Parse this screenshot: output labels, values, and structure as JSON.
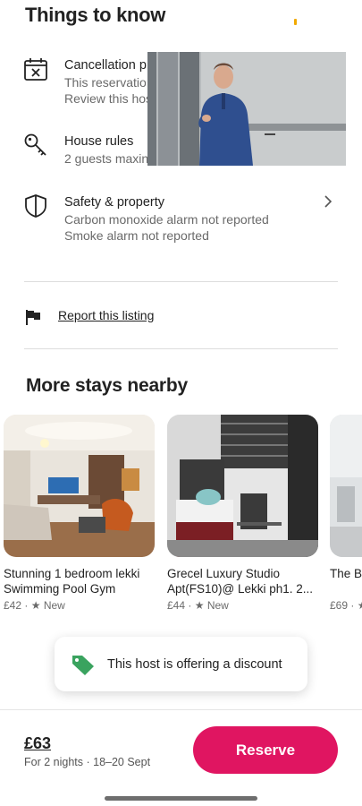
{
  "things_to_know": {
    "title": "Things to know",
    "items": [
      {
        "icon": "calendar-x-icon",
        "title": "Cancellation p",
        "lines": [
          "This reservatio",
          "Review this hos"
        ]
      },
      {
        "icon": "key-icon",
        "title": "House rules",
        "lines": [
          "2 guests maxin"
        ]
      },
      {
        "icon": "shield-icon",
        "title": "Safety & property",
        "lines": [
          "Carbon monoxide alarm not reported",
          "Smoke alarm not reported"
        ]
      }
    ]
  },
  "report": {
    "icon": "flag-icon",
    "label": "Report this listing"
  },
  "nearby": {
    "title": "More stays nearby",
    "cards": [
      {
        "line1": "Stunning 1 bedroom lekki",
        "line2": "Swimming Pool Gym",
        "price": "£42",
        "rating": "New"
      },
      {
        "line1": "Grecel Luxury Studio",
        "line2": "Apt(FS10)@ Lekki ph1. 2...",
        "price": "£44",
        "rating": "New"
      },
      {
        "line1": "The B",
        "line2": "",
        "price": "£69",
        "rating": ""
      }
    ]
  },
  "toast": {
    "icon": "price-tag-icon",
    "text": "This host is offering a discount"
  },
  "footer": {
    "price": "£63",
    "dates": "For 2 nights · 18–20 Sept",
    "reserve_label": "Reserve"
  },
  "colors": {
    "accent": "#e01561",
    "text": "#222222",
    "muted": "#6a6a6a",
    "tag_green": "#3aa35f"
  }
}
